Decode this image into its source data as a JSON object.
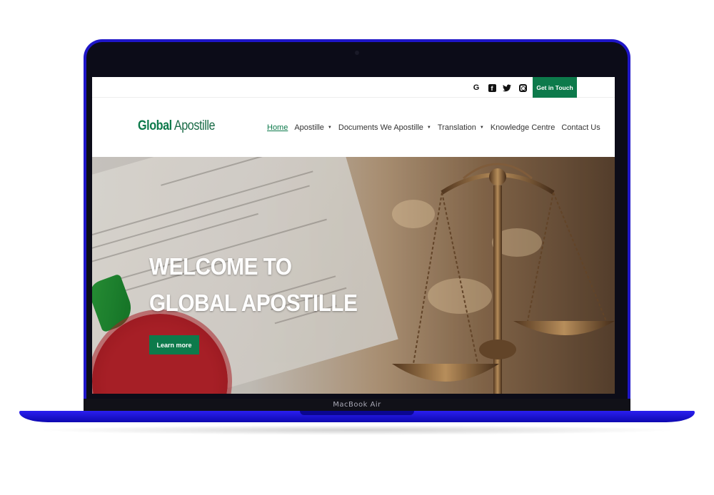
{
  "device": {
    "label": "MacBook Air"
  },
  "topbar": {
    "social_icons": [
      "google-icon",
      "facebook-icon",
      "twitter-icon",
      "instagram-icon"
    ],
    "google_glyph": "G",
    "facebook_glyph": "f",
    "cta_label": "Get in Touch"
  },
  "header": {
    "logo_strong": "Global",
    "logo_light": " Apostille",
    "nav": [
      {
        "label": "Home",
        "active": true,
        "dropdown": false
      },
      {
        "label": "Apostille",
        "active": false,
        "dropdown": true
      },
      {
        "label": "Documents We Apostille",
        "active": false,
        "dropdown": true
      },
      {
        "label": "Translation",
        "active": false,
        "dropdown": true
      },
      {
        "label": "Knowledge Centre",
        "active": false,
        "dropdown": false
      },
      {
        "label": "Contact Us",
        "active": false,
        "dropdown": false
      }
    ],
    "dropdown_glyph": "▼"
  },
  "hero": {
    "title_line1": "WELCOME TO",
    "title_line2": "GLOBAL APOSTILLE",
    "button_label": "Learn more"
  },
  "colors": {
    "brand_green": "#0d7a4b",
    "laptop_frame": "#1f16c8",
    "nav_text": "#333333"
  }
}
